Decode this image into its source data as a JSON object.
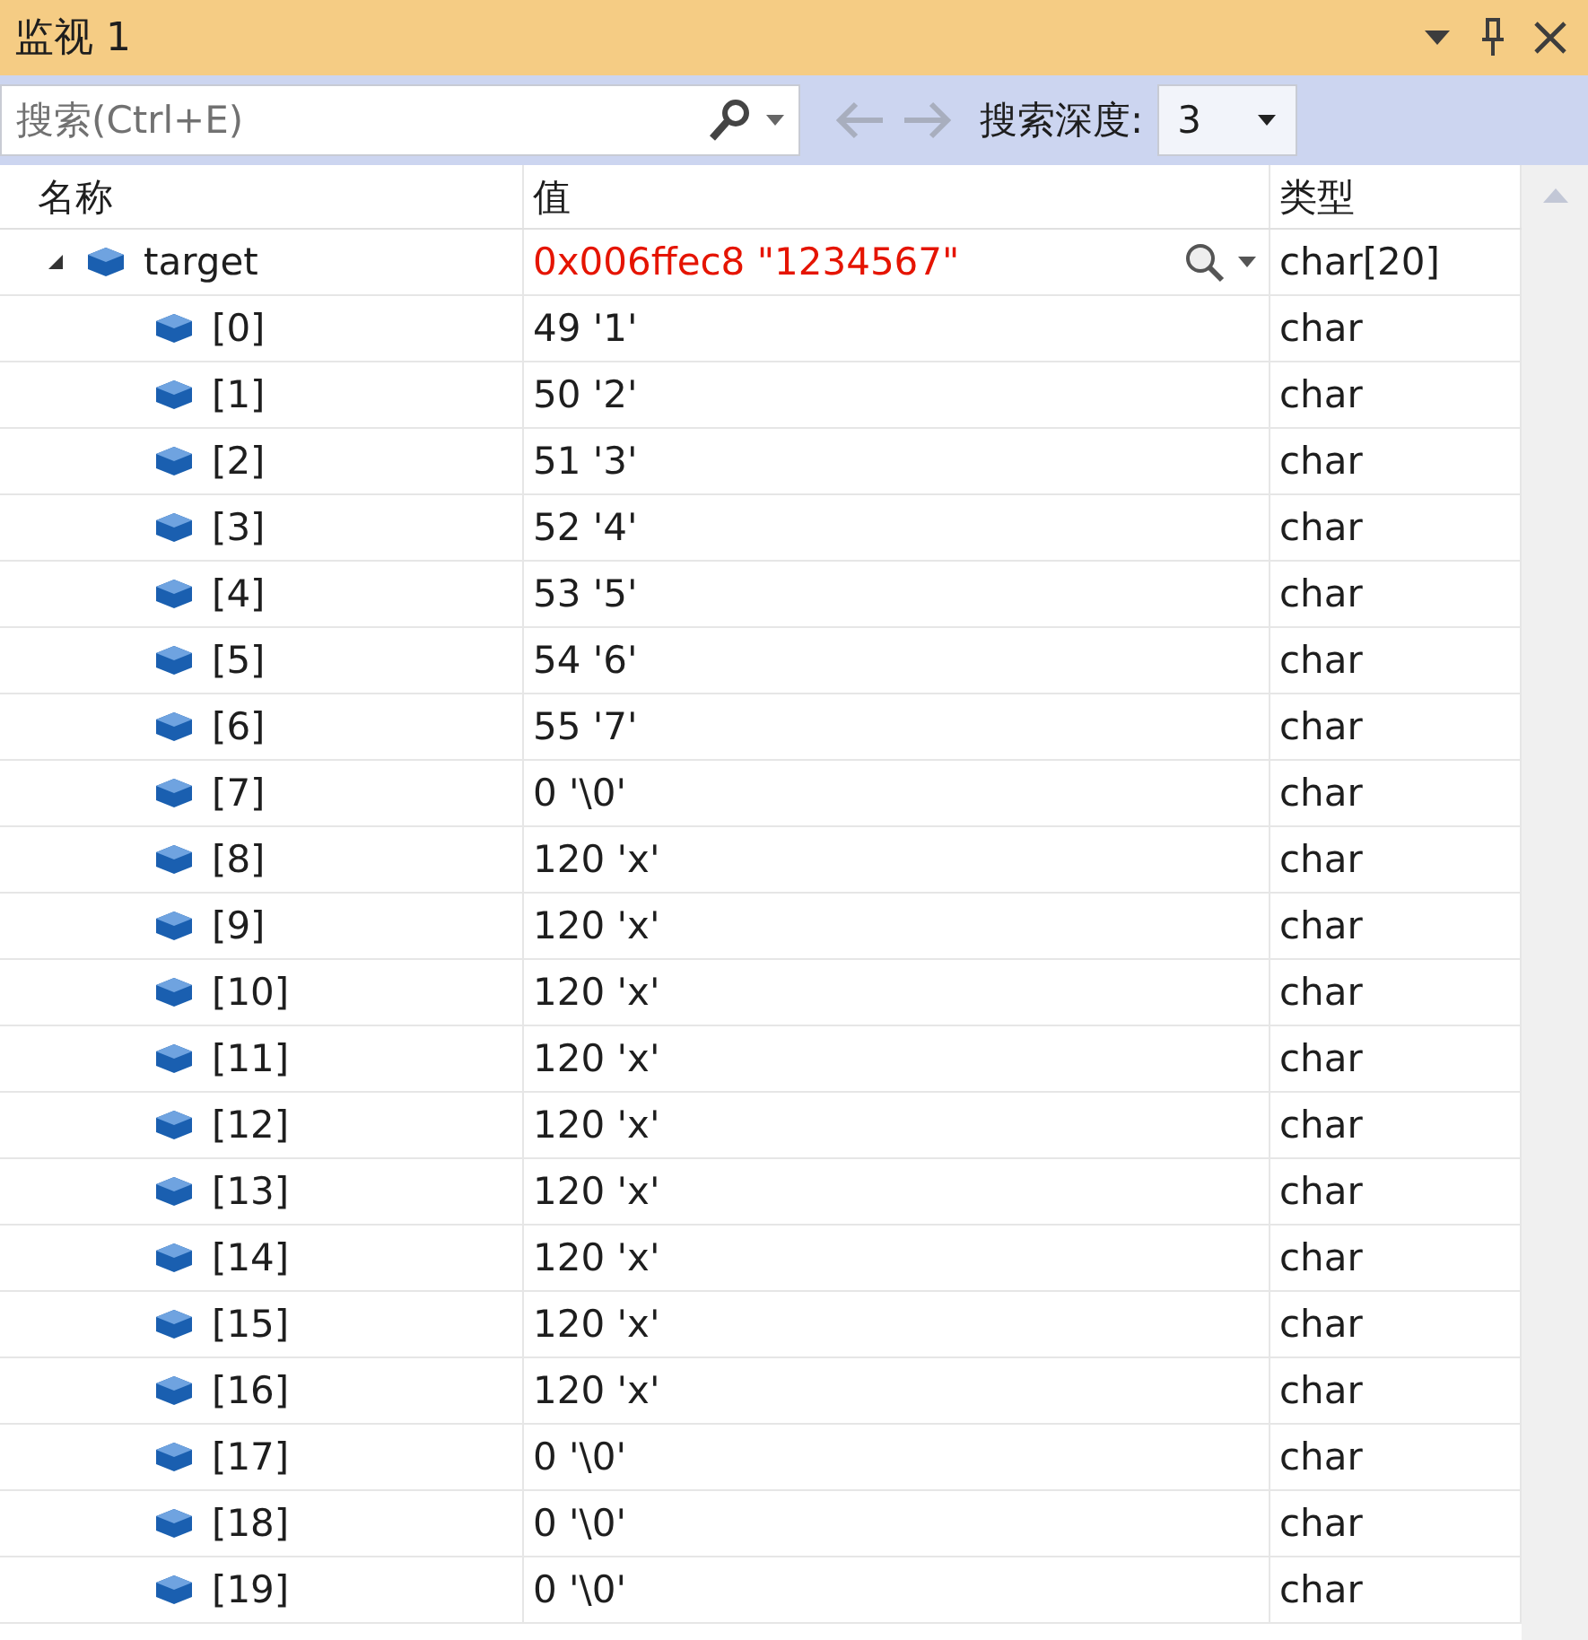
{
  "window": {
    "title": "监视 1"
  },
  "toolbar": {
    "search": {
      "placeholder": "搜索(Ctrl+E)"
    },
    "depth_label": "搜索深度:",
    "depth_value": "3"
  },
  "table": {
    "columns": [
      "名称",
      "值",
      "类型"
    ],
    "rows": [
      {
        "name": "target",
        "value": "0x006ffec8 \"1234567\"",
        "type": "char[20]",
        "changed": true,
        "expanded": true,
        "children": [
          {
            "name": "[0]",
            "value": "49 '1'",
            "type": "char",
            "changed": false
          },
          {
            "name": "[1]",
            "value": "50 '2'",
            "type": "char",
            "changed": false
          },
          {
            "name": "[2]",
            "value": "51 '3'",
            "type": "char",
            "changed": false
          },
          {
            "name": "[3]",
            "value": "52 '4'",
            "type": "char",
            "changed": false
          },
          {
            "name": "[4]",
            "value": "53 '5'",
            "type": "char",
            "changed": false
          },
          {
            "name": "[5]",
            "value": "54 '6'",
            "type": "char",
            "changed": false
          },
          {
            "name": "[6]",
            "value": "55 '7'",
            "type": "char",
            "changed": false
          },
          {
            "name": "[7]",
            "value": "0 '\\0'",
            "type": "char",
            "changed": false
          },
          {
            "name": "[8]",
            "value": "120 'x'",
            "type": "char",
            "changed": false
          },
          {
            "name": "[9]",
            "value": "120 'x'",
            "type": "char",
            "changed": false
          },
          {
            "name": "[10]",
            "value": "120 'x'",
            "type": "char",
            "changed": false
          },
          {
            "name": "[11]",
            "value": "120 'x'",
            "type": "char",
            "changed": false
          },
          {
            "name": "[12]",
            "value": "120 'x'",
            "type": "char",
            "changed": false
          },
          {
            "name": "[13]",
            "value": "120 'x'",
            "type": "char",
            "changed": false
          },
          {
            "name": "[14]",
            "value": "120 'x'",
            "type": "char",
            "changed": false
          },
          {
            "name": "[15]",
            "value": "120 'x'",
            "type": "char",
            "changed": false
          },
          {
            "name": "[16]",
            "value": "120 'x'",
            "type": "char",
            "changed": false
          },
          {
            "name": "[17]",
            "value": "0 '\\0'",
            "type": "char",
            "changed": false
          },
          {
            "name": "[18]",
            "value": "0 '\\0'",
            "type": "char",
            "changed": false
          },
          {
            "name": "[19]",
            "value": "0 '\\0'",
            "type": "char",
            "changed": false
          }
        ]
      }
    ]
  }
}
